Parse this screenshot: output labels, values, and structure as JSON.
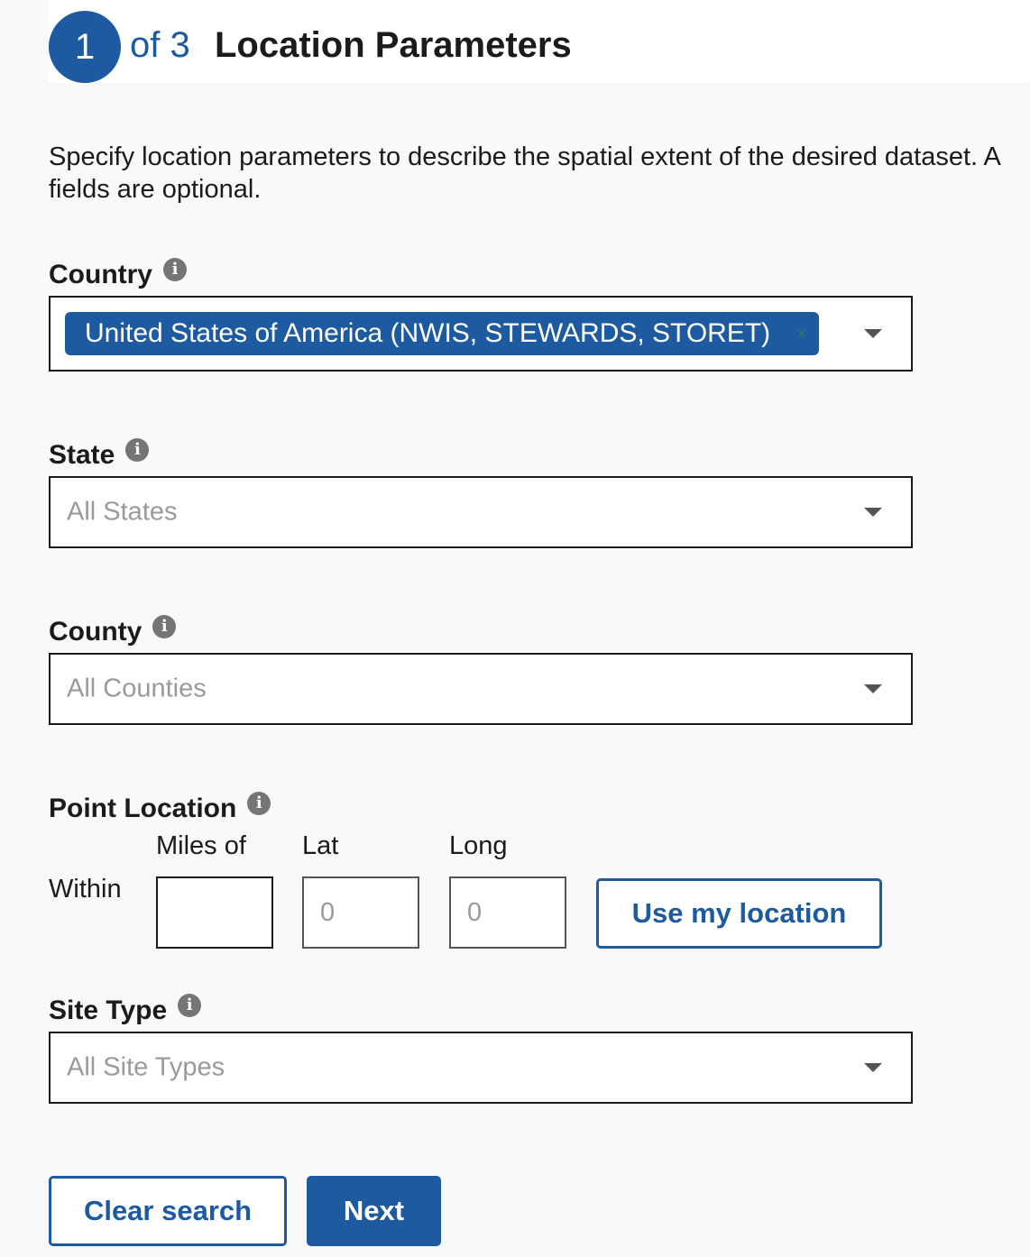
{
  "header": {
    "step_number": "1",
    "step_of": "of 3",
    "title": "Location Parameters"
  },
  "description": {
    "line1": "Specify location parameters to describe the spatial extent of the desired dataset. A",
    "line2": "fields are optional."
  },
  "country": {
    "label": "Country",
    "selected": "United States of America (NWIS, STEWARDS, STORET)",
    "remove_glyph": "×"
  },
  "state": {
    "label": "State",
    "placeholder": "All States"
  },
  "county": {
    "label": "County",
    "placeholder": "All Counties"
  },
  "point_location": {
    "label": "Point Location",
    "within_label": "Within",
    "miles_label": "Miles of",
    "lat_label": "Lat",
    "long_label": "Long",
    "miles_value": "",
    "lat_placeholder": "0",
    "long_placeholder": "0",
    "use_location_label": "Use my location"
  },
  "site_type": {
    "label": "Site Type",
    "placeholder": "All Site Types"
  },
  "actions": {
    "clear_label": "Clear search",
    "next_label": "Next"
  },
  "icons": {
    "info": "info-icon",
    "dropdown": "chevron-down-icon",
    "remove": "close-icon"
  },
  "colors": {
    "primary": "#1e5aa0",
    "text": "#1b1b1b",
    "placeholder": "#9a9a9a",
    "background": "#f9f9f9"
  }
}
